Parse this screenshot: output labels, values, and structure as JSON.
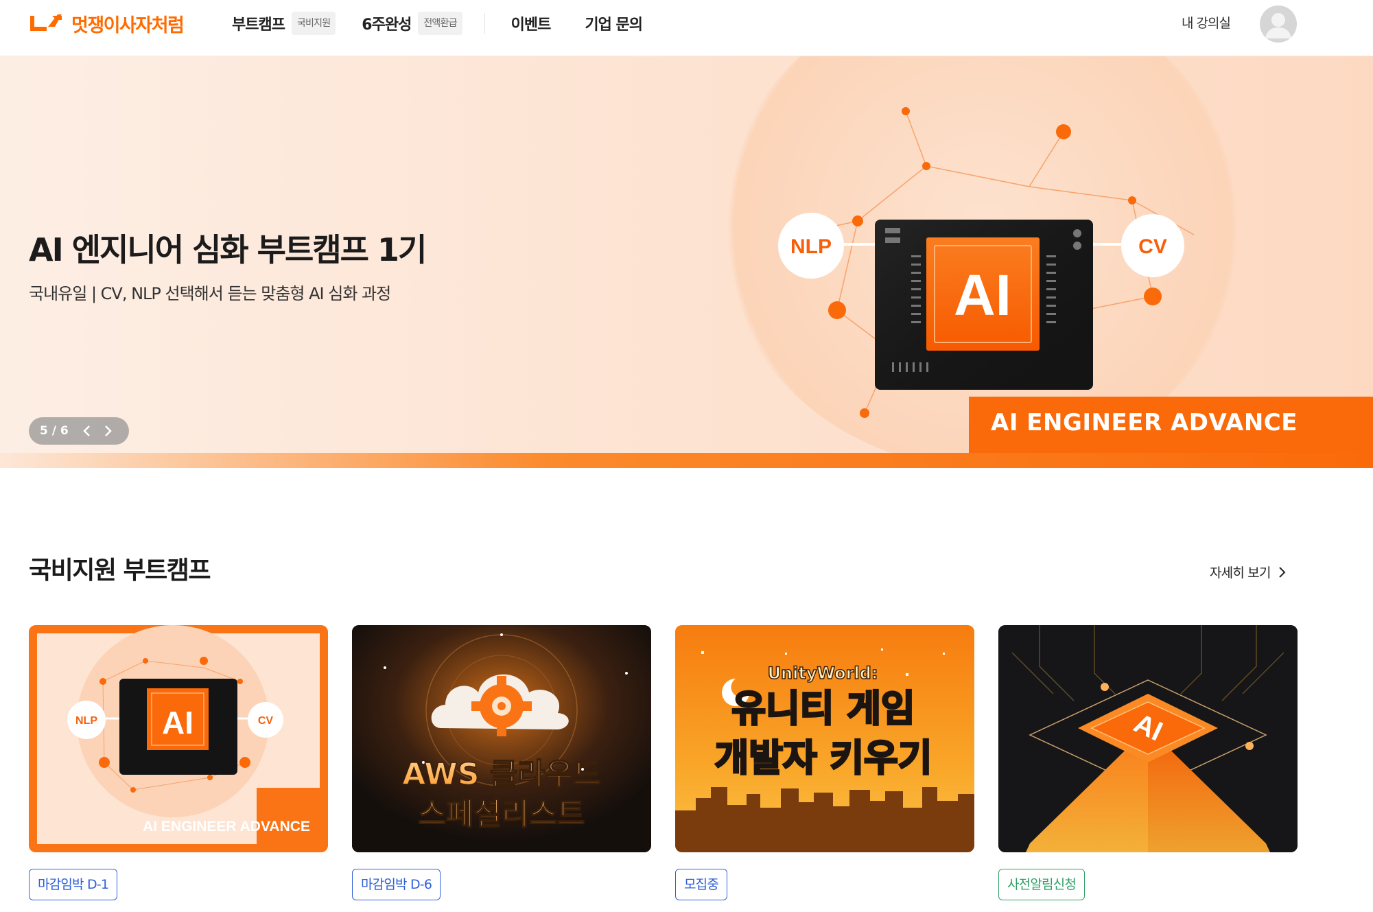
{
  "header": {
    "logo_text": "멋쟁이사자처럼",
    "nav": [
      {
        "label": "부트캠프",
        "badge": "국비지원"
      },
      {
        "label": "6주완성",
        "badge": "전액환급"
      }
    ],
    "links": [
      "이벤트",
      "기업 문의"
    ],
    "my_classroom": "내 강의실"
  },
  "hero": {
    "title": "AI 엔지니어 심화 부트캠프 1기",
    "subtitle": "국내유일 | CV, NLP 선택해서 듣는 맞춤형 AI 심화 과정",
    "image": {
      "chip_text": "AI",
      "left_bubble": "NLP",
      "right_bubble": "CV",
      "tag": "AI ENGINEER ADVANCE"
    },
    "pager": "5 / 6"
  },
  "section": {
    "title": "국비지원 부트캠프",
    "more": "자세히 보기"
  },
  "cards": [
    {
      "art": {
        "chip": "AI",
        "left": "NLP",
        "right": "CV",
        "tag": "AI ENGINEER ADVANCE"
      },
      "status": "마감임박 D-1"
    },
    {
      "art": {
        "line1": "AWS 클라우드",
        "line2": "스페셜리스트"
      },
      "status": "마감임박 D-6"
    },
    {
      "art": {
        "brand": "UnityWorld:",
        "line1": "유니티 게임",
        "line2": "개발자 키우기"
      },
      "status": "모집중"
    },
    {
      "art": {
        "chip": "AI"
      },
      "status": "사전알림신청"
    }
  ],
  "colors": {
    "brand": "#ff6b00",
    "status_blue": "#2f5fd7",
    "status_green": "#2ea066"
  }
}
